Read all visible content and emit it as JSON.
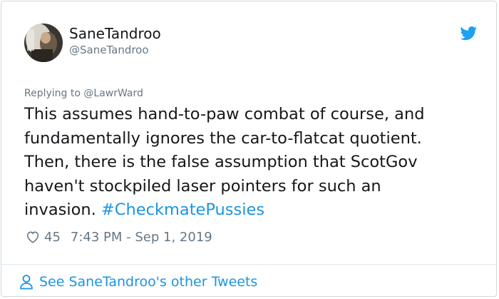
{
  "author": {
    "display_name": "SaneTandroo",
    "handle": "@SaneTandroo"
  },
  "reply": {
    "prefix": "Replying to ",
    "target": "@LawrWard"
  },
  "tweet": {
    "text": "This assumes hand-to-paw combat of course, and\nfundamentally ignores the car-to-flatcat quotient.\nThen, there is the false assumption that ScotGov\nhaven't stockpiled laser pointers for such an\ninvasion. ",
    "hashtag": "#CheckmatePussies"
  },
  "meta": {
    "likes": "45",
    "timestamp": "7:43 PM - Sep 1, 2019"
  },
  "footer": {
    "link_text": "See SaneTandroo's other Tweets"
  },
  "colors": {
    "link": "#1b95e0",
    "secondary_text": "#657786",
    "primary_text": "#14171a",
    "twitter_brand": "#1da1f2"
  },
  "icons": [
    "twitter-bird-icon",
    "heart-icon",
    "person-icon"
  ]
}
